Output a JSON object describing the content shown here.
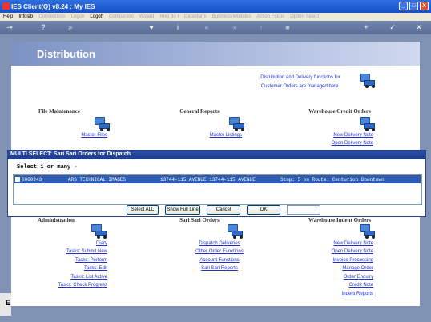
{
  "window": {
    "title": "IES Client(Q) v8.24 : My IES",
    "controls": [
      "_",
      "□",
      "X"
    ]
  },
  "menu": {
    "items": [
      {
        "label": "Help",
        "enabled": true
      },
      {
        "label": "Infolab",
        "enabled": true
      },
      {
        "label": "Connections",
        "enabled": false
      },
      {
        "label": "Logon",
        "enabled": false
      },
      {
        "label": "Logoff",
        "enabled": true
      },
      {
        "label": "Companion",
        "enabled": false
      },
      {
        "label": "Wizard",
        "enabled": false
      },
      {
        "label": "How do I",
        "enabled": false
      },
      {
        "label": "DataMarts",
        "enabled": false
      },
      {
        "label": "Business Modules",
        "enabled": false
      },
      {
        "label": "Action Focus",
        "enabled": false
      },
      {
        "label": "Option Select",
        "enabled": false
      }
    ]
  },
  "toolbar": {
    "icons": [
      {
        "name": "key-icon",
        "glyph": "⊸"
      },
      {
        "name": "help-icon",
        "glyph": "?"
      },
      {
        "name": "search-icon",
        "glyph": "⌕"
      },
      {
        "name": "heart-icon",
        "glyph": "♥"
      },
      {
        "name": "info-icon",
        "glyph": "i"
      },
      {
        "name": "first-icon",
        "glyph": "«"
      },
      {
        "name": "last-icon",
        "glyph": "»"
      },
      {
        "name": "up-icon",
        "glyph": "↑"
      },
      {
        "name": "square-icon",
        "glyph": "■"
      },
      {
        "name": "plus-icon",
        "glyph": "+"
      },
      {
        "name": "check-icon",
        "glyph": "✓"
      },
      {
        "name": "close-icon",
        "glyph": "✕"
      }
    ]
  },
  "page": {
    "title": "Distribution",
    "info": [
      "Distribution and Delivery functions for",
      "Customer Orders are managed here."
    ]
  },
  "sections": {
    "file_maintenance": {
      "title": "File Maintenance",
      "links": [
        "Master Files"
      ]
    },
    "general_reports": {
      "title": "General Reports",
      "links": [
        "Master Listings"
      ]
    },
    "warehouse_credit": {
      "title": "Warehouse Credit Orders",
      "links": [
        "New Delivery Note",
        "Open Delivery Note"
      ]
    },
    "administration": {
      "title": "Administration",
      "links": [
        "Diary",
        "Tasks: Submit New",
        "Tasks: Perform",
        "Tasks: Edit",
        "Tasks: List Active",
        "Tasks: Check Progress"
      ]
    },
    "sari_sari": {
      "title": "Sari Sari Orders",
      "links": [
        "Dispatch Deliveries",
        "Other Order Functions",
        "Account Functions",
        "Sari Sari Reports"
      ]
    },
    "warehouse_indent": {
      "title": "Warehouse Indent Orders",
      "links": [
        "New Delivery Note",
        "Open Delivery Note",
        "Invoice Processing",
        "Manage Order",
        "Order Enquiry",
        "Credit Note",
        "Indent Reports"
      ]
    }
  },
  "dialog": {
    "title": "MULTI SELECT: Sari Sari Orders for Dispatch",
    "subtitle": "Select 1 or many -",
    "rows": [
      {
        "code": "0000243",
        "name": "ARS TECHNICAL IMAGES",
        "address": "13744-115 AVENUE 13744-115 AVENUE",
        "stop": "Stop: 5 on Route: Centurion Downtown",
        "selected": true
      }
    ],
    "buttons": {
      "select_all": "Select ALL",
      "show_full_line": "Show Full Line",
      "cancel": "Cancel",
      "ok": "OK"
    },
    "input_value": ""
  },
  "side_stub": {
    "label": "E"
  }
}
